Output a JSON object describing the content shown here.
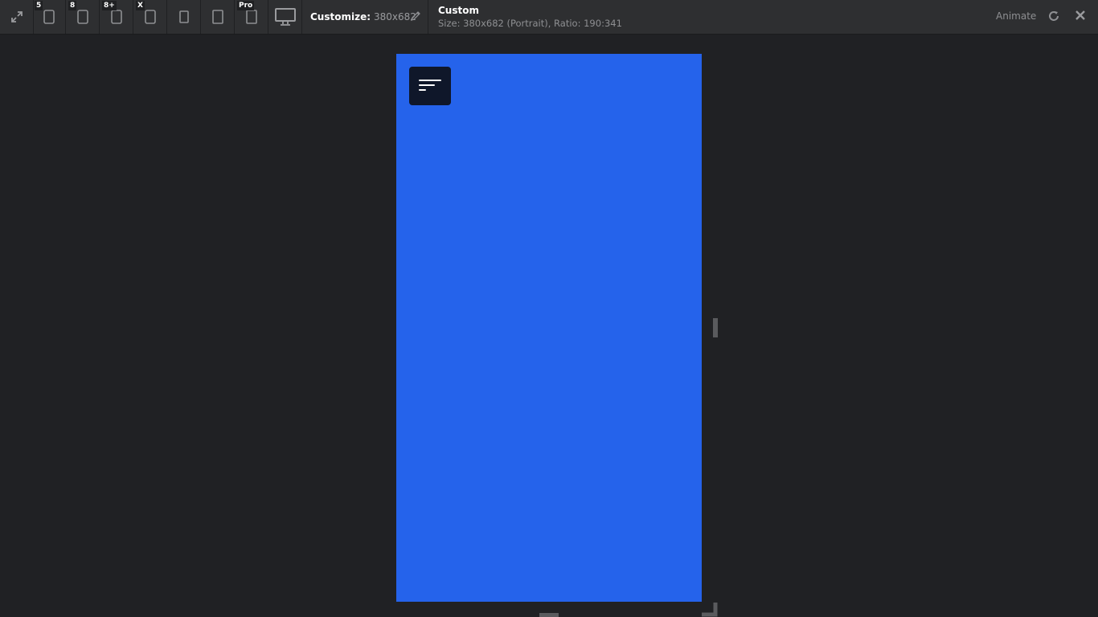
{
  "toolbar": {
    "devices": [
      {
        "badge": "",
        "icon": "fullscreen-icon"
      },
      {
        "badge": "5",
        "icon": "phone-icon"
      },
      {
        "badge": "8",
        "icon": "phone-icon"
      },
      {
        "badge": "8+",
        "icon": "phone-icon"
      },
      {
        "badge": "X",
        "icon": "phone-icon"
      },
      {
        "badge": "",
        "icon": "tablet-icon"
      },
      {
        "badge": "",
        "icon": "tablet-icon"
      },
      {
        "badge": "Pro",
        "icon": "tablet-icon"
      },
      {
        "badge": "",
        "icon": "desktop-icon"
      }
    ],
    "customize_label": "Customize:",
    "customize_value": "380x682",
    "info_title": "Custom",
    "info_subtitle": "Size: 380x682 (Portrait), Ratio: 190:341",
    "animate_label": "Animate"
  },
  "colors": {
    "toolbar_bg": "#2e2f31",
    "page_bg": "#202124",
    "viewport_bg": "#2563eb",
    "menu_button_bg": "#0f172a"
  }
}
